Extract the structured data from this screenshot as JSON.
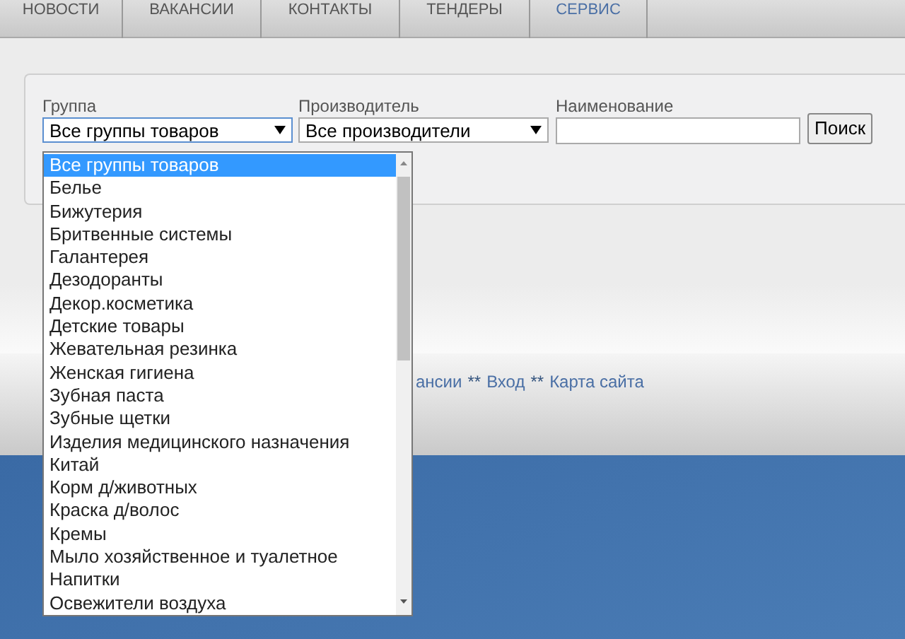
{
  "nav_tabs": [
    {
      "label": "НОВОСТИ",
      "selected": false
    },
    {
      "label": "ВАКАНСИИ",
      "selected": false
    },
    {
      "label": "КОНТАКТЫ",
      "selected": false
    },
    {
      "label": "ТЕНДЕРЫ",
      "selected": false
    },
    {
      "label": "СЕРВИС",
      "selected": true
    }
  ],
  "filter": {
    "group": {
      "label": "Группа",
      "value": "Все группы товаров",
      "expanded": true
    },
    "manufacturer": {
      "label": "Производитель",
      "value": "Все производители"
    },
    "name": {
      "label": "Наименование"
    },
    "search_button": "Поиск"
  },
  "group_options": [
    {
      "label": "Все группы товаров",
      "selected": true
    },
    {
      "label": "Белье",
      "selected": false
    },
    {
      "label": "Бижутерия",
      "selected": false
    },
    {
      "label": "Бритвенные системы",
      "selected": false
    },
    {
      "label": "Галантерея",
      "selected": false
    },
    {
      "label": "Дезодоранты",
      "selected": false
    },
    {
      "label": "Декор.косметика",
      "selected": false
    },
    {
      "label": "Детские товары",
      "selected": false
    },
    {
      "label": "Жевательная резинка",
      "selected": false
    },
    {
      "label": "Женская гигиена",
      "selected": false
    },
    {
      "label": "Зубная паста",
      "selected": false
    },
    {
      "label": "Зубные щетки",
      "selected": false
    },
    {
      "label": "Изделия медицинского назначения",
      "selected": false
    },
    {
      "label": "Китай",
      "selected": false
    },
    {
      "label": "Корм д/животных",
      "selected": false
    },
    {
      "label": "Краска д/волос",
      "selected": false
    },
    {
      "label": "Кремы",
      "selected": false
    },
    {
      "label": "Мыло хозяйственное и туалетное",
      "selected": false
    },
    {
      "label": "Напитки",
      "selected": false
    },
    {
      "label": "Освежители воздуха",
      "selected": false
    }
  ],
  "footer_links": [
    {
      "kind": "link",
      "text": "ансии"
    },
    {
      "kind": "separator",
      "text": "**"
    },
    {
      "kind": "link",
      "text": "Вход"
    },
    {
      "kind": "separator",
      "text": "**"
    },
    {
      "kind": "link",
      "text": "Карта сайта"
    }
  ]
}
